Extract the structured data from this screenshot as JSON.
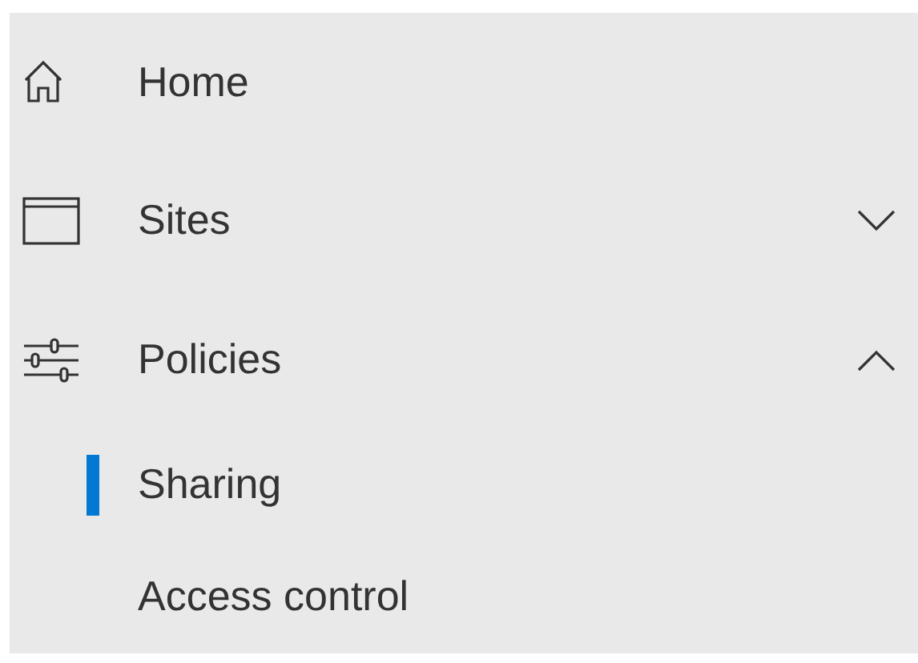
{
  "nav": {
    "items": [
      {
        "label": "Home",
        "kind": "home"
      },
      {
        "label": "Sites",
        "kind": "window",
        "expanded": false
      },
      {
        "label": "Policies",
        "kind": "sliders",
        "expanded": true,
        "children": [
          {
            "label": "Sharing",
            "selected": true
          },
          {
            "label": "Access control",
            "selected": false
          }
        ]
      }
    ]
  }
}
